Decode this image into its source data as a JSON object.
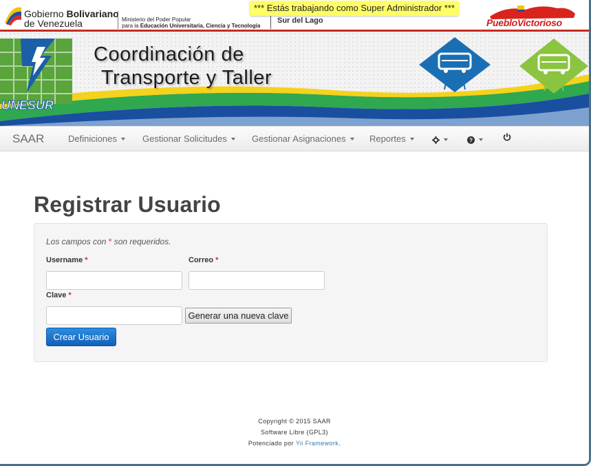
{
  "gov": {
    "name_prefix": "Gobierno",
    "name_bold": "Bolivariano",
    "name_line2": "de Venezuela",
    "ministry_line1": "Ministerio del Poder Popular",
    "ministry_line2_prefix": "para la",
    "ministry_line2_bold": "Educación Universitaria, Ciencia y Tecnología",
    "region": "Sur del Lago",
    "pueblo": "PuebloVictorioso"
  },
  "banner": {
    "super_admin": "*** Estás trabajando como Super Administrador ***",
    "title_line1": "Coordinación de",
    "title_line2": "Transporte y Taller",
    "logo_text": "UNESUR"
  },
  "navbar": {
    "brand": "SAAR",
    "items": [
      {
        "label": "Definiciones"
      },
      {
        "label": "Gestionar Solicitudes"
      },
      {
        "label": "Gestionar Asignaciones"
      },
      {
        "label": "Reportes"
      }
    ],
    "icons": [
      "gear-icon",
      "help-icon",
      "power-icon"
    ]
  },
  "page": {
    "title": "Registrar Usuario",
    "required_note_prefix": "Los campos con",
    "required_star": "*",
    "required_note_suffix": "son requeridos."
  },
  "form": {
    "username_label": "Username",
    "correo_label": "Correo",
    "clave_label": "Clave",
    "username_value": "",
    "correo_value": "",
    "clave_value": "",
    "generate_button": "Generar una nueva clave",
    "submit_button": "Crear Usuario"
  },
  "footer": {
    "copyright": "Copyright © 2015 SAAR",
    "license": "Software Libre (GPL3)",
    "powered_prefix": "Potenciado por",
    "powered_link": "Yii Framework",
    "powered_suffix": "."
  },
  "colors": {
    "accent_red": "#c52b1f",
    "primary_button": "#1a73cf",
    "banner_highlight": "#fffe66"
  }
}
